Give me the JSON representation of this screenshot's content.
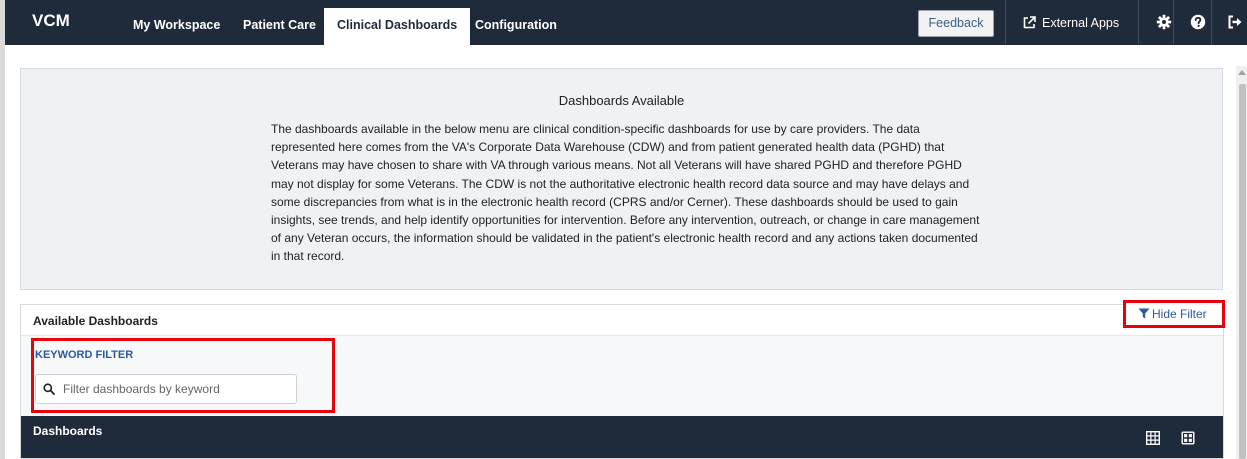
{
  "nav": {
    "brand": "VCM",
    "items": [
      "My Workspace",
      "Patient Care",
      "Clinical Dashboards",
      "Configuration"
    ],
    "active_item": "Clinical Dashboards",
    "feedback_label": "Feedback",
    "external_apps_label": "External Apps",
    "icons": [
      "external-link-icon",
      "gear-icon",
      "help-icon",
      "logout-icon"
    ]
  },
  "info": {
    "title": "Dashboards Available",
    "text": "The dashboards available in the below menu are clinical condition-specific dashboards for use by care providers. The data represented here comes from the VA's Corporate Data Warehouse (CDW) and from patient generated health data (PGHD) that Veterans may have chosen to share with VA through various means. Not all Veterans will have shared PGHD and therefore PGHD may not display for some Veterans. The CDW is not the authoritative electronic health record data source and may have delays and some discrepancies from what is in the electronic health record (CPRS and/or Cerner). These dashboards should be used to gain insights, see trends, and help identify opportunities for intervention. Before any intervention, outreach, or change in care management of any Veteran occurs, the information should be validated in the patient's electronic health record and any actions taken documented in that record."
  },
  "available": {
    "title": "Available Dashboards",
    "hide_filter_label": "Hide Filter",
    "keyword_filter_label": "KEYWORD FILTER",
    "keyword_value": "",
    "keyword_placeholder": "Filter dashboards by keyword",
    "dashboards_label": "Dashboards",
    "view_icons": [
      "grid-view-icon",
      "tile-view-icon"
    ]
  },
  "colors": {
    "nav_bg": "#1f2a3a",
    "highlight": "#e8000b",
    "link": "#2c5aa0",
    "panel_bg": "#eff1f5"
  }
}
